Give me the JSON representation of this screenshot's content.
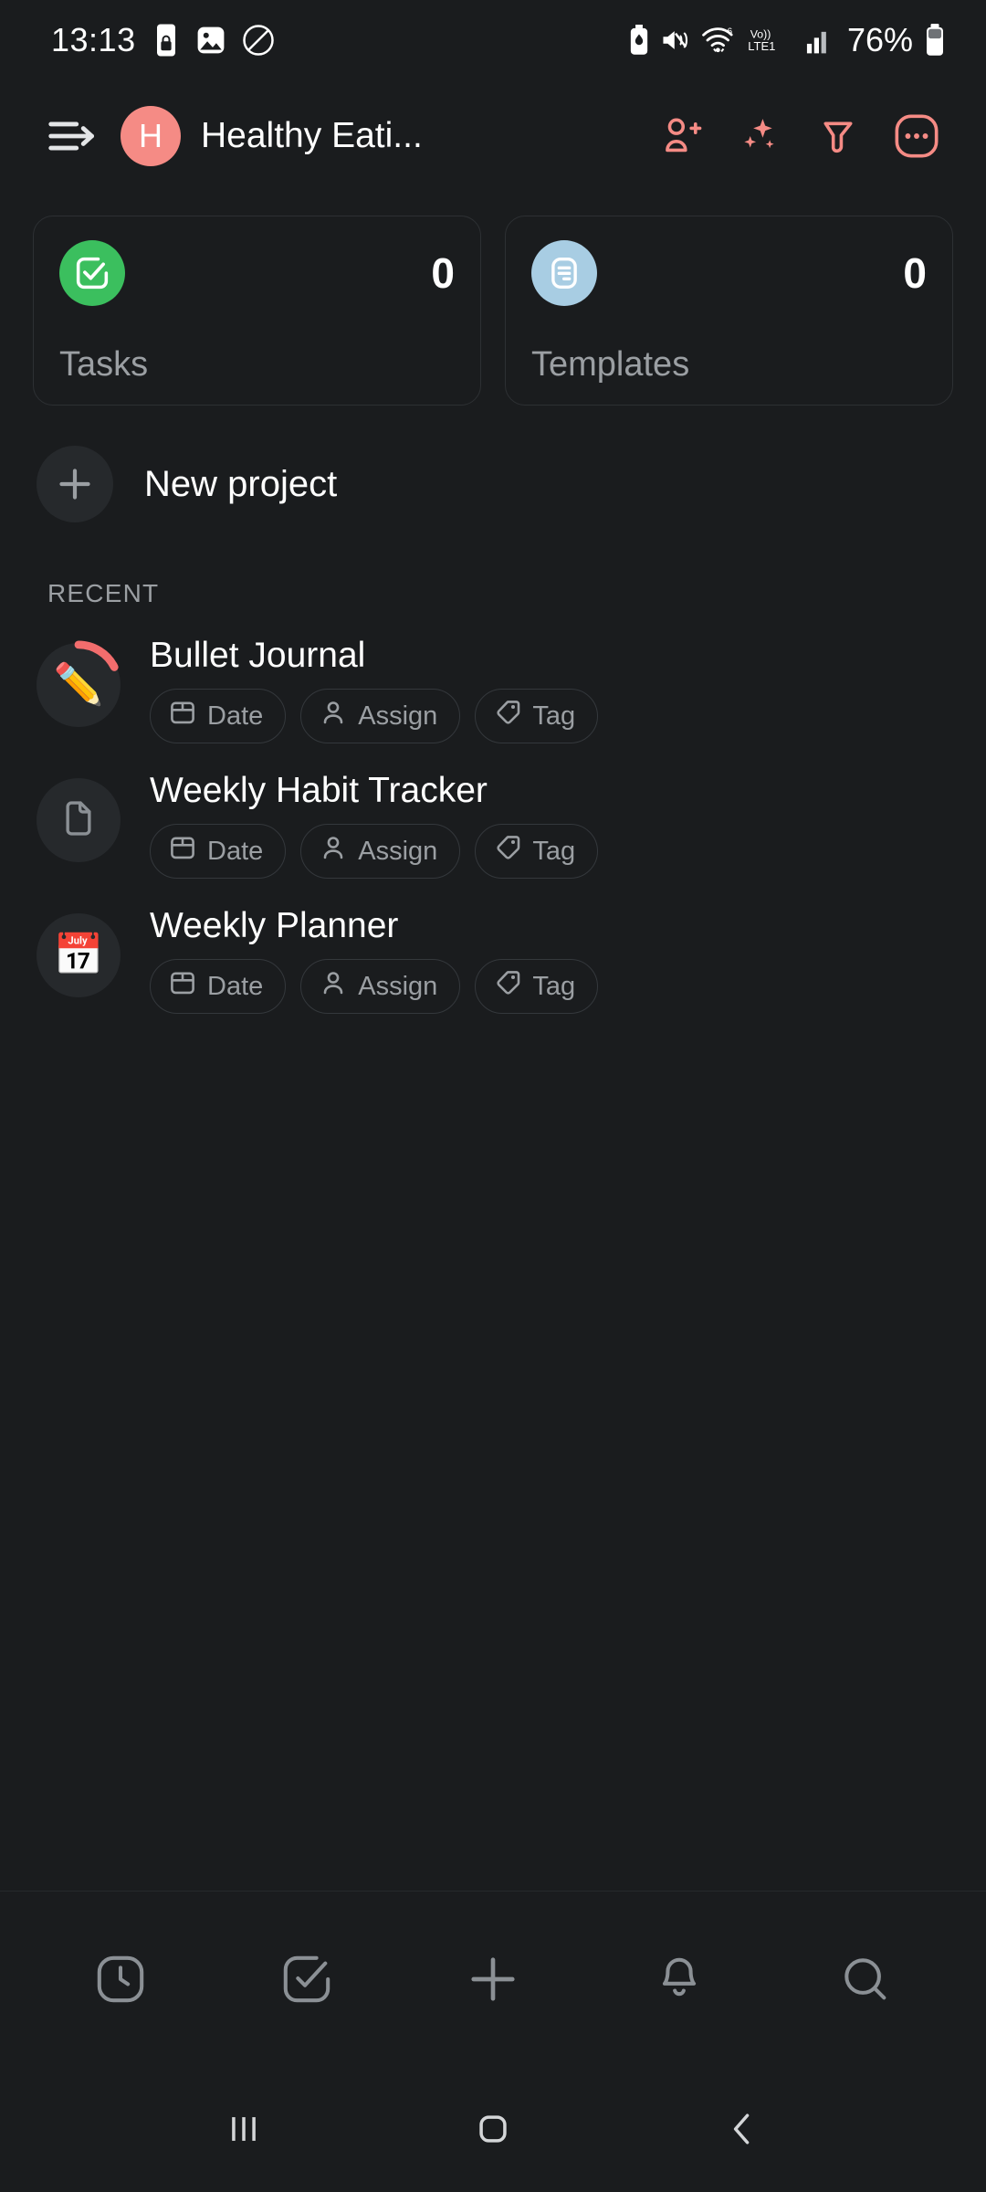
{
  "status_bar": {
    "time": "13:13",
    "battery_percent": "76%",
    "left_icons": [
      "phone-lock-icon",
      "image-icon",
      "circle-slash-icon"
    ],
    "right_icons": [
      "battery-saver-icon",
      "mute-icon",
      "wifi-6-icon",
      "volte-lte1-icon",
      "signal-bars-icon",
      "battery-icon"
    ]
  },
  "header": {
    "menu_icon": "drawer-arrow-icon",
    "avatar_letter": "H",
    "avatar_color": "#f58b85",
    "title": "Healthy Eati...",
    "actions": [
      {
        "name": "add-member-icon",
        "label": "Add member"
      },
      {
        "name": "ai-sparkles-icon",
        "label": "AI"
      },
      {
        "name": "filter-funnel-icon",
        "label": "Filter"
      },
      {
        "name": "more-options-icon",
        "label": "More"
      }
    ],
    "accent_color": "#f58b85"
  },
  "stats": [
    {
      "label": "Tasks",
      "count": "0",
      "icon": "check-square-icon",
      "color": "#3bbf5e"
    },
    {
      "label": "Templates",
      "count": "0",
      "icon": "document-lines-icon",
      "color": "#a8cde3"
    }
  ],
  "new_project": {
    "label": "New project",
    "icon": "plus-icon"
  },
  "recent": {
    "section_label": "RECENT",
    "chip_labels": {
      "date": "Date",
      "assign": "Assign",
      "tag": "Tag"
    },
    "projects": [
      {
        "name": "Bullet Journal",
        "emoji": "✏️",
        "progress_arc": true,
        "arc_color": "#f26d6d",
        "chips": [
          "Date",
          "Assign",
          "Tag"
        ]
      },
      {
        "name": "Weekly Habit Tracker",
        "emoji": "",
        "icon": "file-outline-icon",
        "progress_arc": false,
        "chips": [
          "Date",
          "Assign",
          "Tag"
        ]
      },
      {
        "name": "Weekly Planner",
        "emoji": "📅",
        "progress_arc": false,
        "chips": [
          "Date",
          "Assign",
          "Tag"
        ]
      }
    ]
  },
  "bottom_nav": [
    {
      "name": "recent-clock-icon",
      "label": "Recent"
    },
    {
      "name": "tasks-check-icon",
      "label": "Tasks"
    },
    {
      "name": "add-plus-icon",
      "label": "Add"
    },
    {
      "name": "notifications-bell-icon",
      "label": "Notifications"
    },
    {
      "name": "search-icon",
      "label": "Search"
    }
  ],
  "android_nav": [
    {
      "name": "recents-icon",
      "label": "Recents"
    },
    {
      "name": "home-icon",
      "label": "Home"
    },
    {
      "name": "back-icon",
      "label": "Back"
    }
  ]
}
